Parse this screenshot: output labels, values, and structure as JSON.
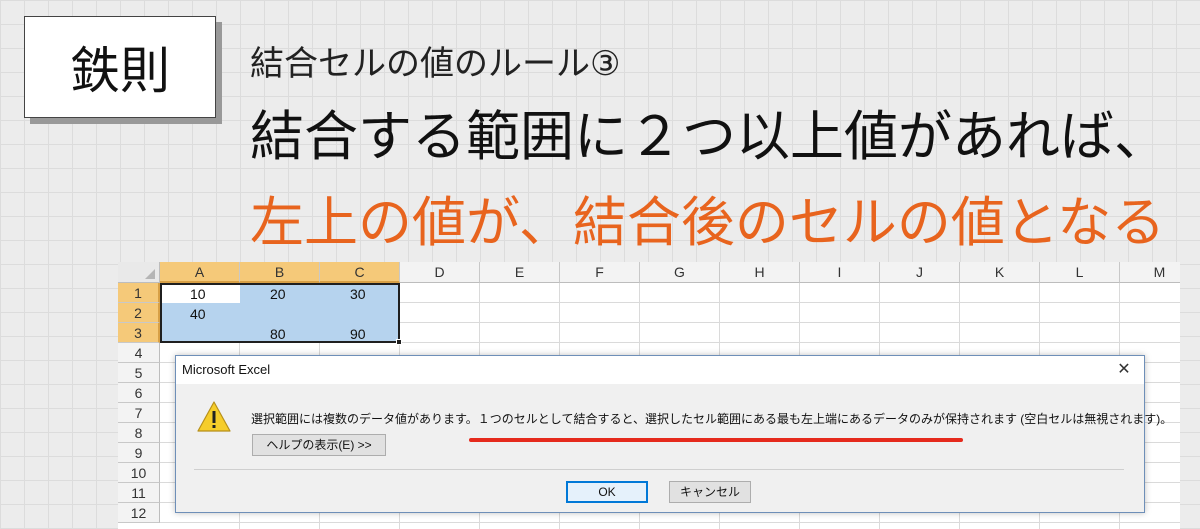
{
  "slide": {
    "tag": "鉄則",
    "subtitle": "結合セルの値のルール③",
    "headline1": "結合する範囲に２つ以上値があれば、",
    "headline2": "左上の値が、結合後のセルの値となる",
    "accent_color": "#e8641e"
  },
  "sheet": {
    "columns": [
      "A",
      "B",
      "C",
      "D",
      "E",
      "F",
      "G",
      "H",
      "I",
      "J",
      "K",
      "L",
      "M"
    ],
    "rows": [
      "1",
      "2",
      "3",
      "4",
      "5",
      "6",
      "7",
      "8",
      "9",
      "10",
      "11",
      "12"
    ],
    "cells": {
      "A1": "10",
      "B1": "20",
      "C1": "30",
      "A2": "40",
      "B3": "80",
      "C3": "90"
    },
    "selection_color": "#b6d3ee"
  },
  "dialog": {
    "title": "Microsoft Excel",
    "close": "✕",
    "icon": "warning-icon",
    "message": "選択範囲には複数のデータ値があります。１つのセルとして結合すると、選択したセル範囲にある最も左上端にあるデータのみが保持されます (空白セルは無視されます)。",
    "help_button": "ヘルプの表示(E) >>",
    "ok_button": "OK",
    "cancel_button": "キャンセル",
    "underline_color": "#e52a1c"
  }
}
